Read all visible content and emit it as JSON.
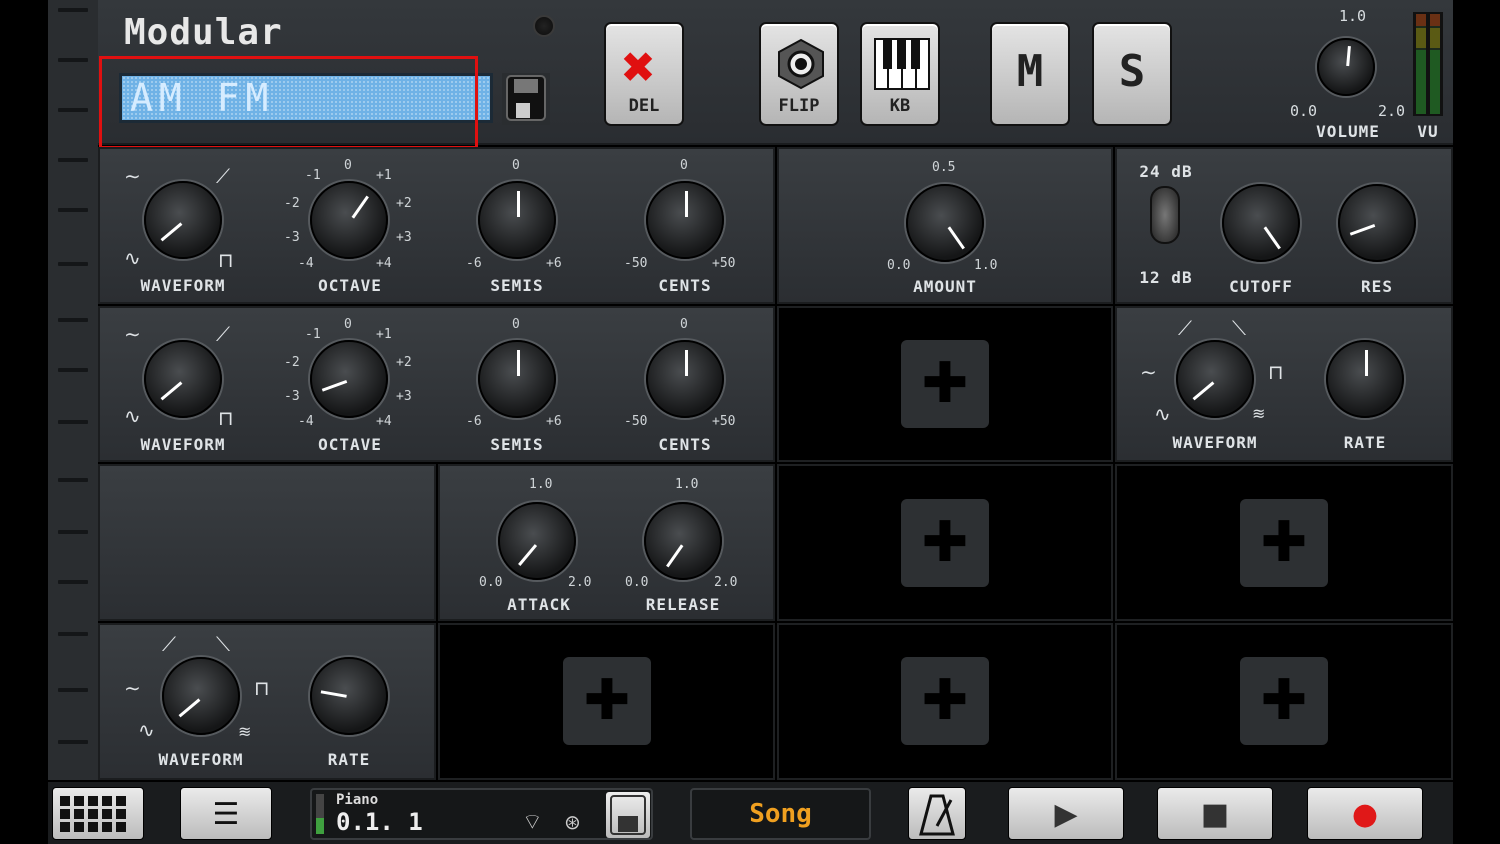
{
  "header": {
    "title": "Modular",
    "patch_name": "AM FM",
    "buttons": {
      "del": "DEL",
      "flip": "FLIP",
      "kb": "KB",
      "mute": "M",
      "solo": "S"
    },
    "volume": {
      "label": "VOLUME",
      "max": "1.0",
      "min": "0.0",
      "high": "2.0",
      "vu_label": "VU"
    }
  },
  "osc1": {
    "waveform": "WAVEFORM",
    "octave": {
      "label": "OCTAVE",
      "marks": [
        "0",
        "-1",
        "+1",
        "-2",
        "+2",
        "-3",
        "+3",
        "-4",
        "+4"
      ]
    },
    "semis": {
      "label": "SEMIS",
      "zero": "0",
      "min": "-6",
      "max": "+6"
    },
    "cents": {
      "label": "CENTS",
      "zero": "0",
      "min": "-50",
      "max": "+50"
    }
  },
  "amount": {
    "label": "AMOUNT",
    "top": "0.5",
    "min": "0.0",
    "max": "1.0"
  },
  "filter": {
    "top": "24 dB",
    "bottom": "12 dB",
    "cutoff": "CUTOFF",
    "res": "RES"
  },
  "osc2": {
    "waveform": "WAVEFORM",
    "octave": {
      "label": "OCTAVE",
      "marks": [
        "0",
        "-1",
        "+1",
        "-2",
        "+2",
        "-3",
        "+3",
        "-4",
        "+4"
      ]
    },
    "semis": {
      "label": "SEMIS",
      "zero": "0",
      "min": "-6",
      "max": "+6"
    },
    "cents": {
      "label": "CENTS",
      "zero": "0",
      "min": "-50",
      "max": "+50"
    }
  },
  "lfo1": {
    "waveform": "WAVEFORM",
    "rate": "RATE"
  },
  "env": {
    "attack": "ATTACK",
    "release": "RELEASE",
    "top": "1.0",
    "min": "0.0",
    "max": "2.0"
  },
  "lfo2": {
    "waveform": "WAVEFORM",
    "rate": "RATE"
  },
  "bottom": {
    "instrument": "Piano",
    "position": "0.1. 1",
    "song": "Song"
  }
}
